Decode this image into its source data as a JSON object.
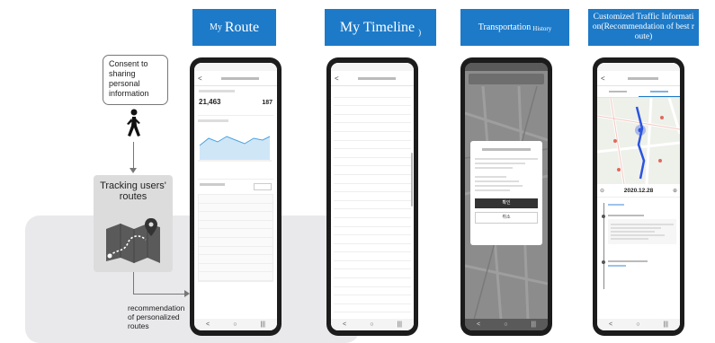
{
  "flow": {
    "consent": "Consent to sharing personal information",
    "tracking": "Tracking users' routes",
    "recommendation": "recommendation of personalized routes"
  },
  "headers": {
    "my_route_small": "My",
    "my_route_big": "Route",
    "my_timeline": "My Timeline",
    "my_timeline_suffix": ")",
    "transport_big": "Transportation",
    "transport_small": "History",
    "customized": "Customized Traffic Information(Recommendation of best route)"
  },
  "phone": {
    "nav_back": "<",
    "nav_home": "○",
    "nav_recent": "|||",
    "popup_confirm": "확인",
    "popup_cancel": "취소",
    "date": "2020.12.28",
    "stat_left": "21,463",
    "stat_right": "187"
  },
  "colors": {
    "header_blue": "#1d7ac8",
    "phone_body": "#1c1c1c"
  }
}
